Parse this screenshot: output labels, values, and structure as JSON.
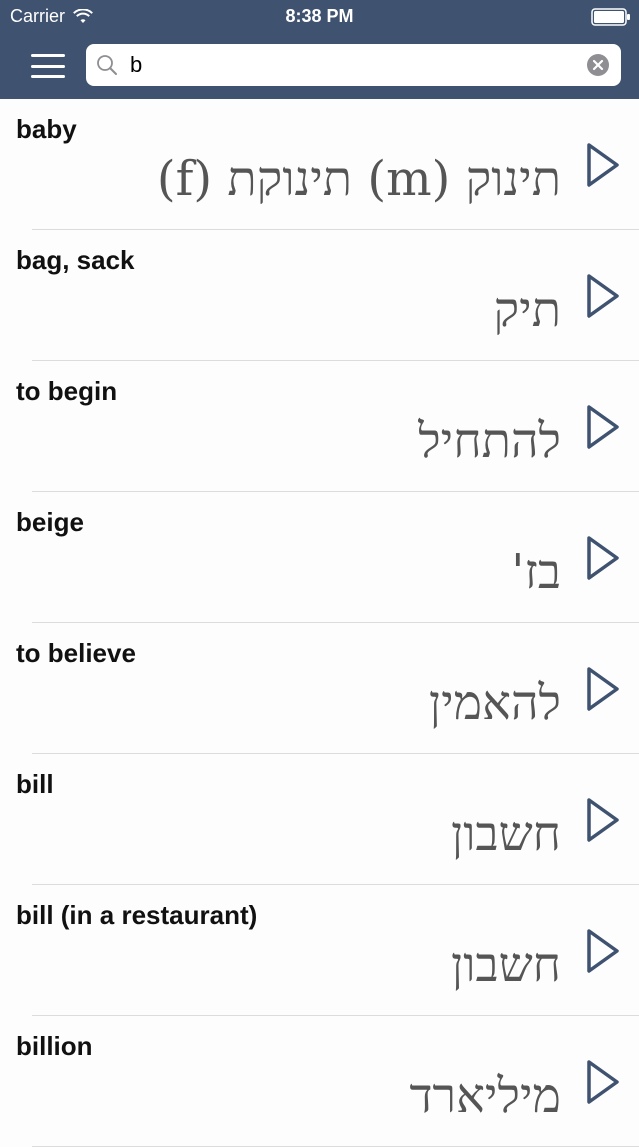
{
  "status_bar": {
    "carrier": "Carrier",
    "time": "8:38 PM"
  },
  "search": {
    "value": "b"
  },
  "entries": [
    {
      "english": "baby",
      "hebrew": "תינוק (m) תינוקת (f)"
    },
    {
      "english": "bag, sack",
      "hebrew": "תיק"
    },
    {
      "english": "to begin",
      "hebrew": "להתחיל"
    },
    {
      "english": "beige",
      "hebrew": "בז'"
    },
    {
      "english": "to believe",
      "hebrew": "להאמין"
    },
    {
      "english": "bill",
      "hebrew": "חשבון"
    },
    {
      "english": "bill (in a restaurant)",
      "hebrew": "חשבון"
    },
    {
      "english": "billion",
      "hebrew": "מיליארד"
    }
  ],
  "icons": {
    "menu": "hamburger-menu-icon",
    "search": "magnifier-icon",
    "clear": "clear-x-icon",
    "play": "play-triangle-icon"
  },
  "colors": {
    "header": "#3f5270",
    "play_icon": "#3f5270",
    "hebrew_text": "#555555"
  }
}
